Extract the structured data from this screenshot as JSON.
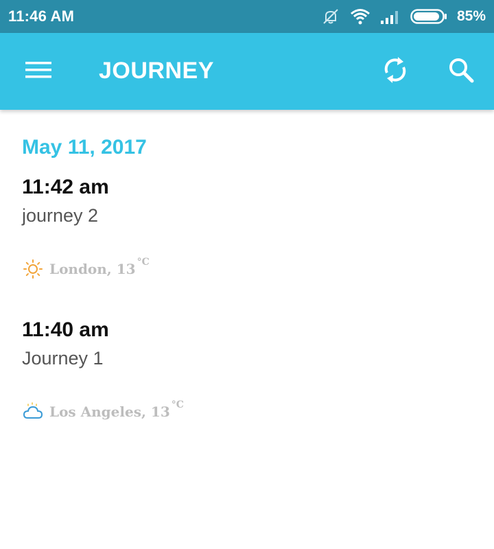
{
  "status_bar": {
    "time": "11:46 AM",
    "battery_percent": "85%",
    "icons": [
      "notifications-off-icon",
      "wifi-icon",
      "signal-icon",
      "battery-icon"
    ]
  },
  "app_bar": {
    "title": "JOURNEY",
    "icons": [
      "menu-icon",
      "sync-icon",
      "search-icon"
    ],
    "background_color": "#35c2e4"
  },
  "date_header": "May 11, 2017",
  "entries": [
    {
      "time": "11:42 am",
      "title": "journey 2",
      "weather": {
        "icon": "sun-icon",
        "location": "London, 13",
        "unit": "°C"
      }
    },
    {
      "time": "11:40 am",
      "title": "Journey 1",
      "weather": {
        "icon": "cloud-icon",
        "location": "Los Angeles, 13",
        "unit": "°C"
      }
    }
  ],
  "colors": {
    "status_bar": "#2a8ca8",
    "accent": "#35c2e4",
    "weather_text": "#bdbdbd"
  }
}
